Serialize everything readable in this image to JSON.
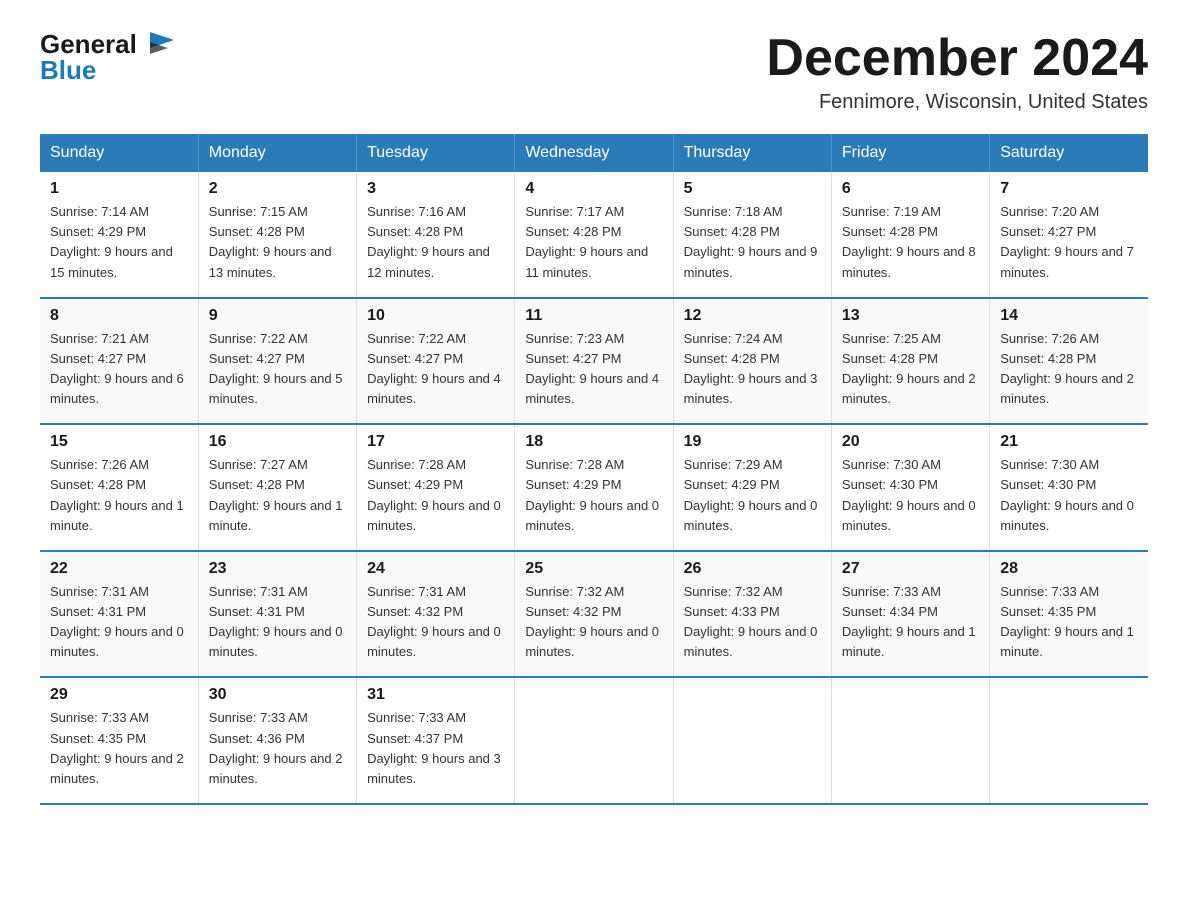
{
  "header": {
    "logo_text_general": "General",
    "logo_text_blue": "Blue",
    "month_title": "December 2024",
    "location": "Fennimore, Wisconsin, United States"
  },
  "weekdays": [
    "Sunday",
    "Monday",
    "Tuesday",
    "Wednesday",
    "Thursday",
    "Friday",
    "Saturday"
  ],
  "weeks": [
    [
      {
        "day": "1",
        "sunrise": "7:14 AM",
        "sunset": "4:29 PM",
        "daylight": "9 hours and 15 minutes."
      },
      {
        "day": "2",
        "sunrise": "7:15 AM",
        "sunset": "4:28 PM",
        "daylight": "9 hours and 13 minutes."
      },
      {
        "day": "3",
        "sunrise": "7:16 AM",
        "sunset": "4:28 PM",
        "daylight": "9 hours and 12 minutes."
      },
      {
        "day": "4",
        "sunrise": "7:17 AM",
        "sunset": "4:28 PM",
        "daylight": "9 hours and 11 minutes."
      },
      {
        "day": "5",
        "sunrise": "7:18 AM",
        "sunset": "4:28 PM",
        "daylight": "9 hours and 9 minutes."
      },
      {
        "day": "6",
        "sunrise": "7:19 AM",
        "sunset": "4:28 PM",
        "daylight": "9 hours and 8 minutes."
      },
      {
        "day": "7",
        "sunrise": "7:20 AM",
        "sunset": "4:27 PM",
        "daylight": "9 hours and 7 minutes."
      }
    ],
    [
      {
        "day": "8",
        "sunrise": "7:21 AM",
        "sunset": "4:27 PM",
        "daylight": "9 hours and 6 minutes."
      },
      {
        "day": "9",
        "sunrise": "7:22 AM",
        "sunset": "4:27 PM",
        "daylight": "9 hours and 5 minutes."
      },
      {
        "day": "10",
        "sunrise": "7:22 AM",
        "sunset": "4:27 PM",
        "daylight": "9 hours and 4 minutes."
      },
      {
        "day": "11",
        "sunrise": "7:23 AM",
        "sunset": "4:27 PM",
        "daylight": "9 hours and 4 minutes."
      },
      {
        "day": "12",
        "sunrise": "7:24 AM",
        "sunset": "4:28 PM",
        "daylight": "9 hours and 3 minutes."
      },
      {
        "day": "13",
        "sunrise": "7:25 AM",
        "sunset": "4:28 PM",
        "daylight": "9 hours and 2 minutes."
      },
      {
        "day": "14",
        "sunrise": "7:26 AM",
        "sunset": "4:28 PM",
        "daylight": "9 hours and 2 minutes."
      }
    ],
    [
      {
        "day": "15",
        "sunrise": "7:26 AM",
        "sunset": "4:28 PM",
        "daylight": "9 hours and 1 minute."
      },
      {
        "day": "16",
        "sunrise": "7:27 AM",
        "sunset": "4:28 PM",
        "daylight": "9 hours and 1 minute."
      },
      {
        "day": "17",
        "sunrise": "7:28 AM",
        "sunset": "4:29 PM",
        "daylight": "9 hours and 0 minutes."
      },
      {
        "day": "18",
        "sunrise": "7:28 AM",
        "sunset": "4:29 PM",
        "daylight": "9 hours and 0 minutes."
      },
      {
        "day": "19",
        "sunrise": "7:29 AM",
        "sunset": "4:29 PM",
        "daylight": "9 hours and 0 minutes."
      },
      {
        "day": "20",
        "sunrise": "7:30 AM",
        "sunset": "4:30 PM",
        "daylight": "9 hours and 0 minutes."
      },
      {
        "day": "21",
        "sunrise": "7:30 AM",
        "sunset": "4:30 PM",
        "daylight": "9 hours and 0 minutes."
      }
    ],
    [
      {
        "day": "22",
        "sunrise": "7:31 AM",
        "sunset": "4:31 PM",
        "daylight": "9 hours and 0 minutes."
      },
      {
        "day": "23",
        "sunrise": "7:31 AM",
        "sunset": "4:31 PM",
        "daylight": "9 hours and 0 minutes."
      },
      {
        "day": "24",
        "sunrise": "7:31 AM",
        "sunset": "4:32 PM",
        "daylight": "9 hours and 0 minutes."
      },
      {
        "day": "25",
        "sunrise": "7:32 AM",
        "sunset": "4:32 PM",
        "daylight": "9 hours and 0 minutes."
      },
      {
        "day": "26",
        "sunrise": "7:32 AM",
        "sunset": "4:33 PM",
        "daylight": "9 hours and 0 minutes."
      },
      {
        "day": "27",
        "sunrise": "7:33 AM",
        "sunset": "4:34 PM",
        "daylight": "9 hours and 1 minute."
      },
      {
        "day": "28",
        "sunrise": "7:33 AM",
        "sunset": "4:35 PM",
        "daylight": "9 hours and 1 minute."
      }
    ],
    [
      {
        "day": "29",
        "sunrise": "7:33 AM",
        "sunset": "4:35 PM",
        "daylight": "9 hours and 2 minutes."
      },
      {
        "day": "30",
        "sunrise": "7:33 AM",
        "sunset": "4:36 PM",
        "daylight": "9 hours and 2 minutes."
      },
      {
        "day": "31",
        "sunrise": "7:33 AM",
        "sunset": "4:37 PM",
        "daylight": "9 hours and 3 minutes."
      },
      null,
      null,
      null,
      null
    ]
  ]
}
